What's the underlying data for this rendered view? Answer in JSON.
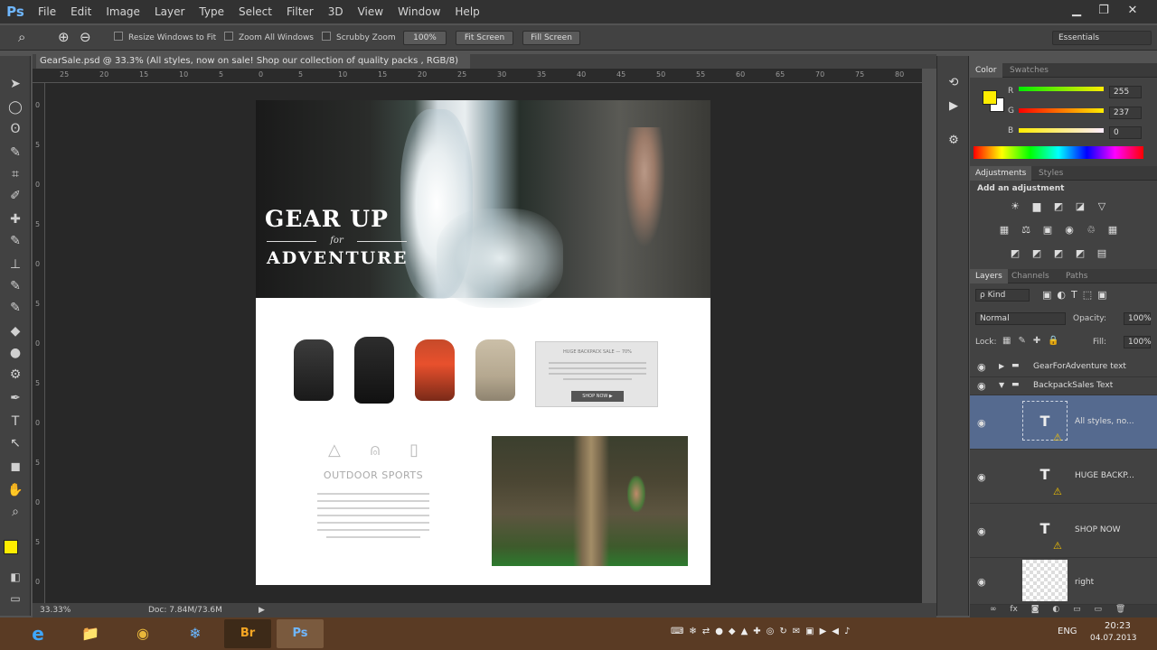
{
  "app": {
    "logo": "Ps"
  },
  "menu": [
    "File",
    "Edit",
    "Image",
    "Layer",
    "Type",
    "Select",
    "Filter",
    "3D",
    "View",
    "Window",
    "Help"
  ],
  "window_controls": {
    "minimize": "▁",
    "restore": "❐",
    "close": "✕"
  },
  "options_bar": {
    "zoom_icon": "⌕",
    "resize_windows": "Resize Windows to Fit",
    "zoom_all": "Zoom All Windows",
    "scrubby": "Scrubby Zoom",
    "btn_100": "100%",
    "btn_fit": "Fit Screen",
    "btn_fill": "Fill Screen",
    "workspace": "Essentials"
  },
  "document": {
    "tab_title": "GearSale.psd @ 33.3% (All styles, now on sale! Shop our collection of  quality packs , RGB/8)",
    "tab_close": "×",
    "ruler_h": [
      "25",
      "20",
      "15",
      "10",
      "5",
      "0",
      "5",
      "10",
      "15",
      "20",
      "25",
      "30",
      "35",
      "40",
      "45",
      "50",
      "55",
      "60",
      "65",
      "70",
      "75",
      "80"
    ],
    "ruler_v": [
      "0",
      "5",
      "0",
      "5",
      "0",
      "5",
      "0",
      "5",
      "0",
      "5",
      "0",
      "5",
      "0"
    ],
    "status_zoom": "33.33%",
    "status_doc": "Doc: 7.84M/73.6M"
  },
  "design": {
    "gear_up": "GEAR UP",
    "for": "for",
    "adventure": "ADVENTURE",
    "sports_title": "OUTDOOR SPORTS",
    "shop_btn": "SHOP NOW ▶",
    "sale_head": "HUGE BACKPACK SALE — 70%"
  },
  "tools": [
    "➤",
    "◯",
    "ʘ",
    "✎",
    "⌗",
    "✐",
    "✚",
    "✎",
    "⊥",
    "✎",
    "✎",
    "◆",
    "●",
    "⚙",
    "✒",
    "T",
    "↖",
    "◼",
    "✋",
    "⌕",
    "⬛",
    "⬜",
    "◧",
    "▭"
  ],
  "color_panel": {
    "tab_color": "Color",
    "tab_swatches": "Swatches",
    "r_label": "R",
    "g_label": "G",
    "b_label": "B",
    "r": "255",
    "g": "237",
    "b": "0",
    "fg": "#ffed00"
  },
  "adjustments": {
    "tab_adj": "Adjustments",
    "tab_styles": "Styles",
    "add_label": "Add an adjustment",
    "row1": [
      "☀",
      "▆",
      "◩",
      "◪",
      "▽"
    ],
    "row2": [
      "▦",
      "⚖",
      "▣",
      "◉",
      "♲",
      "▦"
    ],
    "row3": [
      "◩",
      "◩",
      "◩",
      "◩",
      "▤"
    ]
  },
  "layers": {
    "tab_layers": "Layers",
    "tab_channels": "Channels",
    "tab_paths": "Paths",
    "kind": "ρ Kind",
    "blend": "Normal",
    "opacity_label": "Opacity:",
    "opacity": "100%",
    "lock_label": "Lock:",
    "fill_label": "Fill:",
    "fill": "100%",
    "groups": [
      {
        "name": "GearForAdventure text",
        "arrow": "▶"
      },
      {
        "name": "BackpackSales Text",
        "arrow": "▼"
      }
    ],
    "items": [
      {
        "name": "All styles, no...",
        "thumb": "T"
      },
      {
        "name": "HUGE BACKP...",
        "thumb": "T"
      },
      {
        "name": "SHOP NOW",
        "thumb": "T"
      },
      {
        "name": "right",
        "thumb": ""
      }
    ],
    "footer": [
      "∞",
      "fx",
      "◙",
      "◐",
      "▭",
      "▭",
      "🗑"
    ]
  },
  "taskbar": {
    "apps": [
      "e",
      "📁",
      "◉",
      "❄",
      "Br",
      "Ps"
    ],
    "lang": "ENG",
    "time": "20:23",
    "date": "04.07.2013"
  }
}
